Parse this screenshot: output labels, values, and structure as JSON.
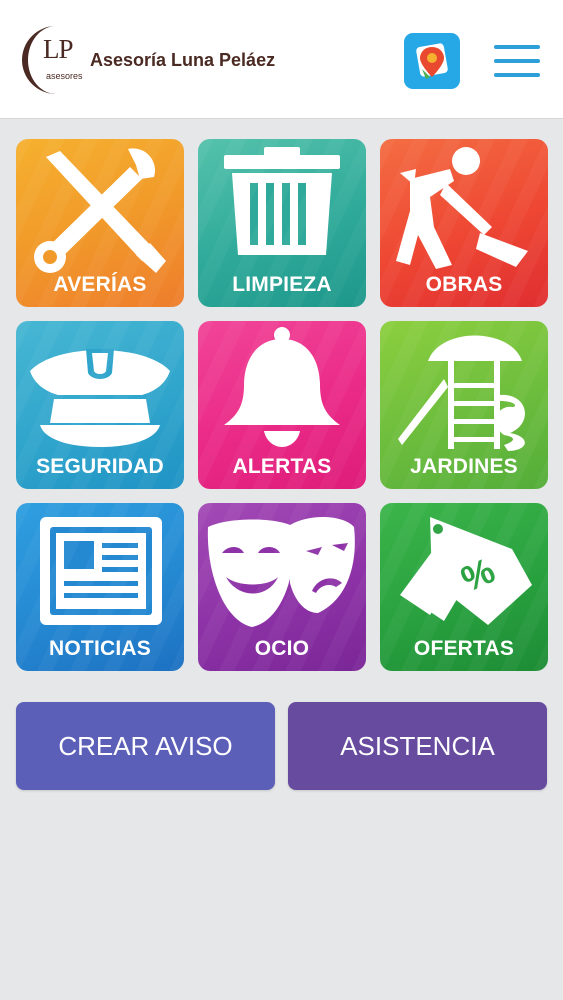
{
  "header": {
    "logo_mark": "LP",
    "logo_sub": "asesores",
    "company_name": "Asesoría Luna Peláez"
  },
  "tiles": [
    {
      "label": "AVERÍAS",
      "icon": "tools-icon"
    },
    {
      "label": "LIMPIEZA",
      "icon": "trash-icon"
    },
    {
      "label": "OBRAS",
      "icon": "worker-shovel-icon"
    },
    {
      "label": "SEGURIDAD",
      "icon": "police-cap-icon"
    },
    {
      "label": "ALERTAS",
      "icon": "bell-icon"
    },
    {
      "label": "JARDINES",
      "icon": "playground-icon"
    },
    {
      "label": "NOTICIAS",
      "icon": "newspaper-icon"
    },
    {
      "label": "OCIO",
      "icon": "theater-masks-icon"
    },
    {
      "label": "OFERTAS",
      "icon": "discount-tag-icon"
    }
  ],
  "actions": {
    "create_label": "CREAR AVISO",
    "assist_label": "ASISTENCIA"
  },
  "colors": {
    "background": "#e6e7e9",
    "brand_text": "#4a2a22",
    "menu": "#2d9fd9",
    "create_button": "#5b5fb8",
    "assist_button": "#674b9f"
  }
}
